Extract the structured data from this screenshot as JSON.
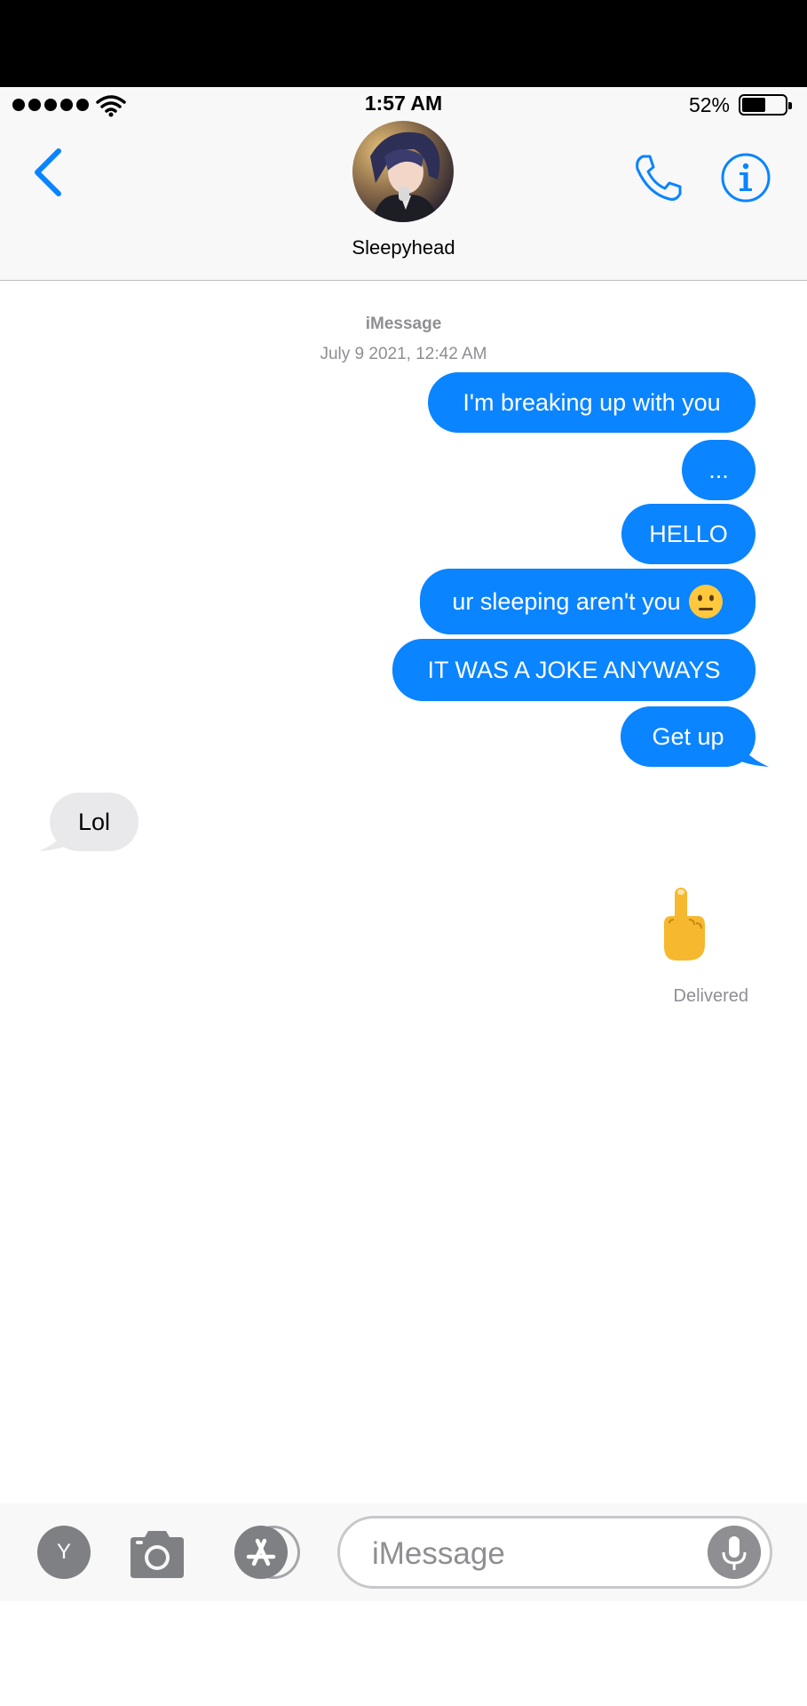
{
  "status": {
    "time": "1:57 AM",
    "battery_percent": "52%",
    "battery_level": 0.52,
    "signal_bars": 5
  },
  "header": {
    "contact_name": "Sleepyhead"
  },
  "conversation": {
    "service": "iMessage",
    "date": "July 9 2021, 12:42 AM",
    "messages": [
      {
        "from": "me",
        "text": "I'm breaking up with you"
      },
      {
        "from": "me",
        "text": "..."
      },
      {
        "from": "me",
        "text": "HELLO"
      },
      {
        "from": "me",
        "text": "ur sleeping aren't you",
        "emoji": "neutral-face"
      },
      {
        "from": "me",
        "text": "IT WAS A JOKE ANYWAYS"
      },
      {
        "from": "me",
        "text": "Get up"
      },
      {
        "from": "them",
        "text": "Lol"
      },
      {
        "from": "me",
        "emoji": "middle-finger"
      }
    ],
    "delivered": "Delivered"
  },
  "composer": {
    "app_letter": "Y",
    "placeholder": "iMessage"
  },
  "colors": {
    "accent": "#0a84ff",
    "sent_bubble": "#0a84ff",
    "received_bubble": "#e9e9eb",
    "meta_text": "#8e8e93"
  }
}
